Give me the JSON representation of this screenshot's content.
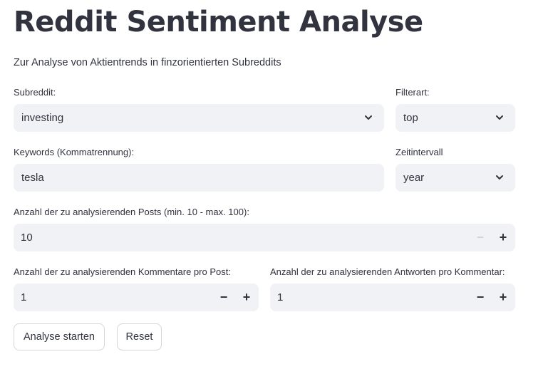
{
  "header": {
    "title": "Reddit Sentiment Analyse",
    "subtitle": "Zur Analyse von Aktientrends in finzorientierten Subreddits"
  },
  "subreddit": {
    "label": "Subreddit:",
    "value": "investing"
  },
  "filterart": {
    "label": "Filterart:",
    "value": "top"
  },
  "keywords": {
    "label": "Keywords (Kommatrennung):",
    "value": "tesla"
  },
  "zeitintervall": {
    "label": "Zeitintervall",
    "value": "year"
  },
  "posts": {
    "label": "Anzahl der zu analysierenden Posts (min. 10 - max. 100):",
    "value": "10",
    "minus": "−",
    "plus": "+"
  },
  "kommentare": {
    "label": "Anzahl der zu analysierenden Kommentare pro Post:",
    "value": "1",
    "minus": "−",
    "plus": "+"
  },
  "antworten": {
    "label": "Anzahl der zu analysierenden Antworten pro Kommentar:",
    "value": "1",
    "minus": "−",
    "plus": "+"
  },
  "buttons": {
    "start": "Analyse starten",
    "reset": "Reset"
  },
  "icons": {
    "dropdown": "chevron-down-icon"
  }
}
